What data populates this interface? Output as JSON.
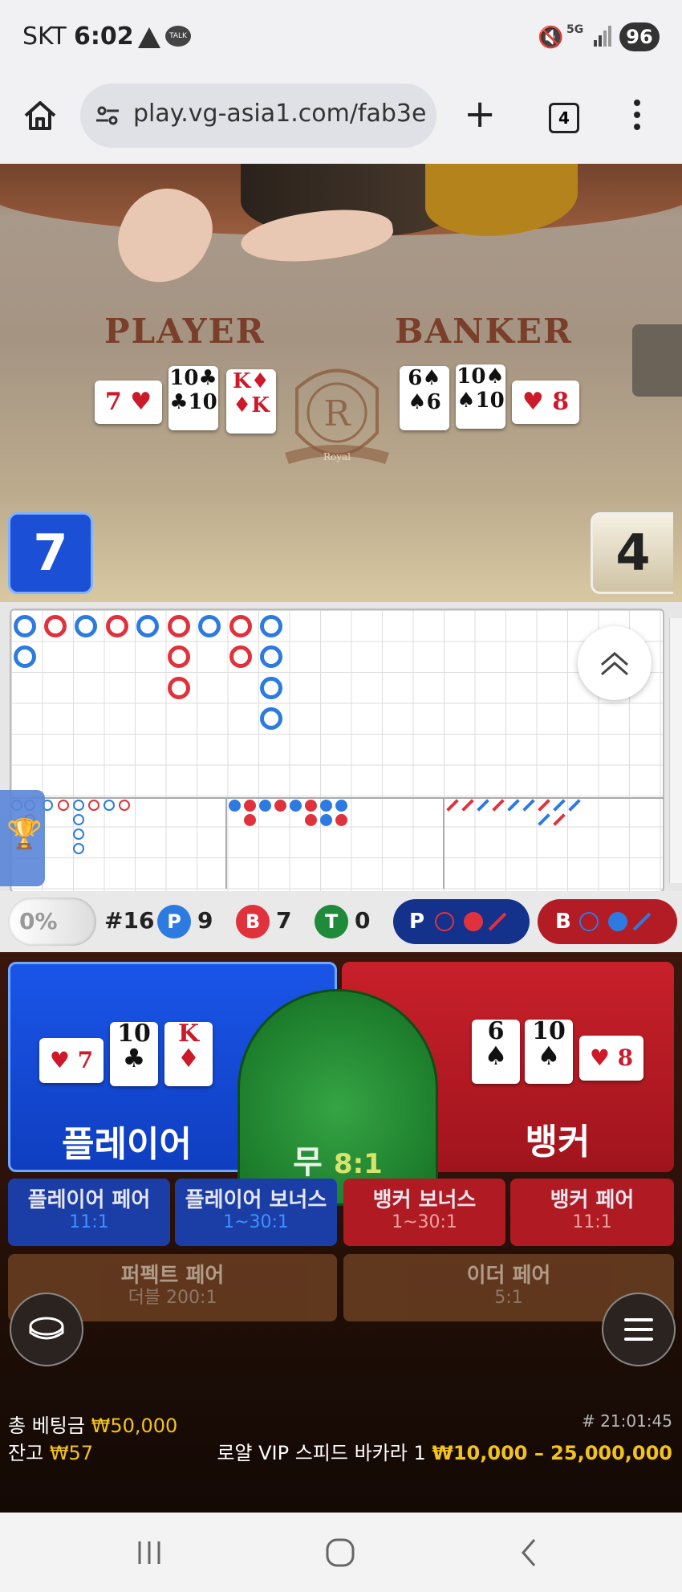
{
  "status": {
    "carrier": "SKT",
    "time": "6:02",
    "talk_label": "TALK",
    "network": "5G",
    "battery": "96"
  },
  "browser": {
    "url": "play.vg-asia1.com/fab3e",
    "tab_count": "4"
  },
  "table": {
    "player_label": "PLAYER",
    "banker_label": "BANKER",
    "crest_letter": "R",
    "crest_text": "Royal",
    "player_cards": [
      {
        "rank": "7",
        "suit": "♥",
        "color": "red",
        "orientation": "sideways"
      },
      {
        "rank": "10",
        "suit": "♣",
        "color": "black",
        "orientation": "upright"
      },
      {
        "rank": "K",
        "suit": "♦",
        "color": "red",
        "orientation": "upright"
      }
    ],
    "banker_cards": [
      {
        "rank": "6",
        "suit": "♠",
        "color": "black",
        "orientation": "upright"
      },
      {
        "rank": "10",
        "suit": "♠",
        "color": "black",
        "orientation": "upright"
      },
      {
        "rank": "8",
        "suit": "♥",
        "color": "red",
        "orientation": "sideways"
      }
    ],
    "player_score": "7",
    "banker_score": "4"
  },
  "stats": {
    "percent": "0%",
    "shoe": "#16",
    "player_chip": "P",
    "player_count": "9",
    "banker_chip": "B",
    "banker_count": "7",
    "tie_chip": "T",
    "tie_count": "0",
    "ask_player": "P",
    "ask_banker": "B"
  },
  "bets": {
    "player": "플레이어",
    "tie": "무",
    "tie_odds": "8:1",
    "banker": "뱅커",
    "player_pair": {
      "name": "플레이어 페어",
      "odds": "11:1"
    },
    "player_bonus": {
      "name": "플레이어 보너스",
      "odds": "1~30:1"
    },
    "banker_bonus": {
      "name": "뱅커 보너스",
      "odds": "1~30:1"
    },
    "banker_pair": {
      "name": "뱅커 페어",
      "odds": "11:1"
    },
    "perfect_pair": {
      "name": "퍼펙트 페어",
      "odds": "더블 200:1"
    },
    "either_pair": {
      "name": "이더 페어",
      "odds": "5:1"
    }
  },
  "footer": {
    "total_bet_label": "총 베팅금",
    "total_bet_value": "₩50,000",
    "balance_label": "잔고",
    "balance_value": "₩57",
    "round_id": "# 21:01:45",
    "table_name": "로얄 VIP 스피드 바카라 1",
    "limits": "₩10,000 – 25,000,000"
  },
  "colors": {
    "player_blue": "#1a55e8",
    "banker_red": "#c8202a",
    "tie_green": "#1b7a2a",
    "gold": "#f2c318"
  }
}
